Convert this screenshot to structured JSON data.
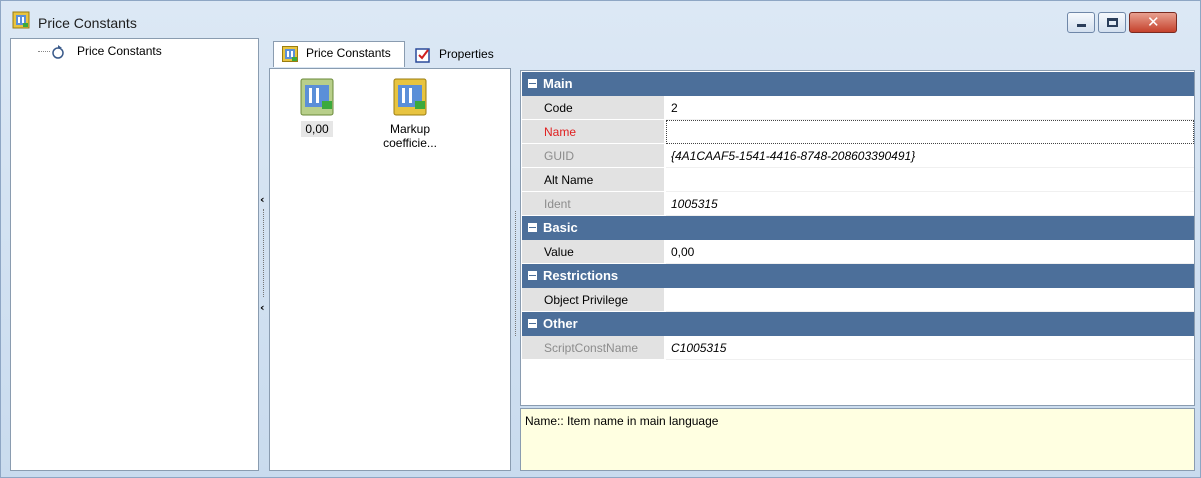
{
  "window": {
    "title": "Price Constants",
    "controls": {
      "minimize": "minimize",
      "maximize": "maximize",
      "close": "✕"
    }
  },
  "tree": {
    "items": [
      {
        "label": "Price Constants"
      }
    ]
  },
  "tabs": [
    {
      "label": "Price Constants",
      "icon": "price-constants-icon",
      "active": true
    },
    {
      "label": "Properties",
      "icon": "properties-icon",
      "active": false
    }
  ],
  "items_view": [
    {
      "label": "0,00",
      "selected": true
    },
    {
      "label": "Markup coefficie...",
      "selected": false
    }
  ],
  "properties": {
    "categories": [
      {
        "name": "Main",
        "rows": [
          {
            "name": "Code",
            "value": "2"
          },
          {
            "name": "Name",
            "value": ""
          },
          {
            "name": "GUID",
            "value": "{4A1CAAF5-1541-4416-8748-208603390491}"
          },
          {
            "name": "Alt Name",
            "value": ""
          },
          {
            "name": "Ident",
            "value": "1005315"
          }
        ]
      },
      {
        "name": "Basic",
        "rows": [
          {
            "name": "Value",
            "value": "0,00"
          }
        ]
      },
      {
        "name": "Restrictions",
        "rows": [
          {
            "name": "Object Privilege",
            "value": ""
          }
        ]
      },
      {
        "name": "Other",
        "rows": [
          {
            "name": "ScriptConstName",
            "value": "C1005315"
          }
        ]
      }
    ]
  },
  "description": "Name:: Item name in main language",
  "colors": {
    "category_header": "#4c6f9a",
    "required_name": "#e02020",
    "description_bg": "#ffffe1"
  }
}
